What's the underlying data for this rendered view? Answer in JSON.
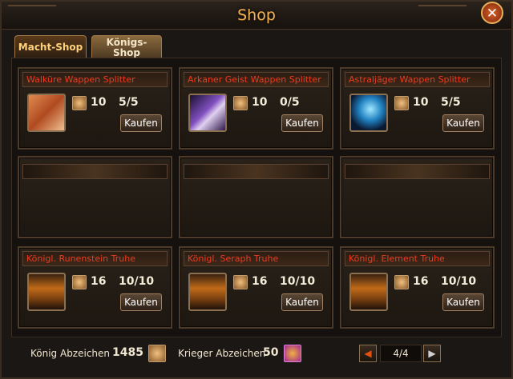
{
  "window": {
    "title": "Shop",
    "close_icon": "close-icon"
  },
  "tabs": [
    {
      "label": "Macht-Shop",
      "active": true
    },
    {
      "label": "Königs-\nShop",
      "active": false
    }
  ],
  "items": [
    {
      "name": "Walküre Wappen Splitter",
      "icon": "walkuere-portrait",
      "cost": "10",
      "stock": "5/5",
      "buy_label": "Kaufen"
    },
    {
      "name": "Arkaner Geist Wappen Splitter",
      "icon": "arkaner-geist-portrait",
      "cost": "10",
      "stock": "0/5",
      "buy_label": "Kaufen"
    },
    {
      "name": "Astraljäger Wappen Splitter",
      "icon": "astraljaeger-portrait",
      "cost": "10",
      "stock": "5/5",
      "buy_label": "Kaufen"
    },
    {
      "name": "Königl. Runenstein Truhe",
      "icon": "treasure-chest",
      "cost": "16",
      "stock": "10/10",
      "buy_label": "Kaufen"
    },
    {
      "name": "Königl. Seraph Truhe",
      "icon": "treasure-chest",
      "cost": "16",
      "stock": "10/10",
      "buy_label": "Kaufen"
    },
    {
      "name": "Königl. Element Truhe",
      "icon": "treasure-chest",
      "cost": "16",
      "stock": "10/10",
      "buy_label": "Kaufen"
    }
  ],
  "footer": {
    "koenig_label": "König Abzeichen",
    "koenig_value": "1485",
    "krieger_label": "Krieger Abzeichen",
    "krieger_value": "50",
    "page": "4/4"
  },
  "colors": {
    "title": "#f0b255",
    "item_name": "#f03a1e",
    "accent_orange": "#e05010"
  }
}
